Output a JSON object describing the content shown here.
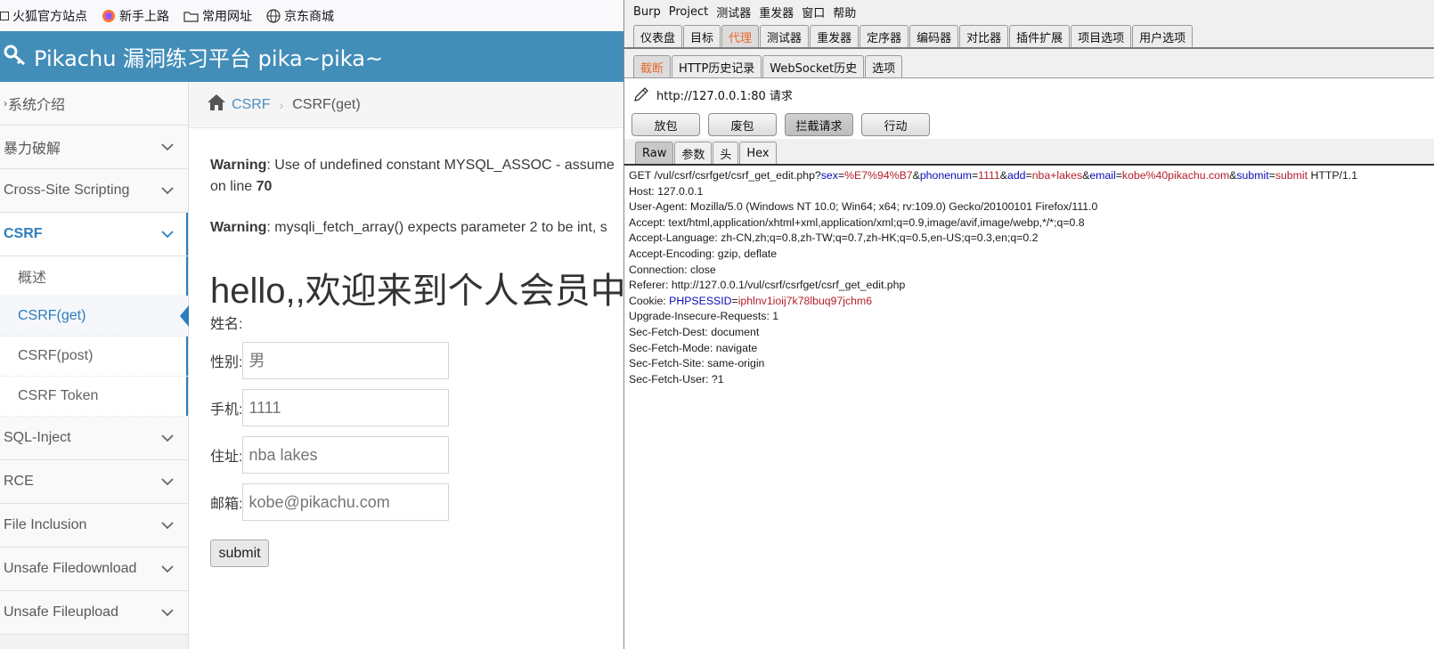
{
  "bookmarks": [
    {
      "icon": "checkbox-icon",
      "label": "火狐官方站点"
    },
    {
      "icon": "firefox-icon",
      "label": "新手上路"
    },
    {
      "icon": "folder-icon",
      "label": "常用网址"
    },
    {
      "icon": "globe-icon",
      "label": "京东商城"
    }
  ],
  "header": {
    "title": "Pikachu 漏洞练习平台 pika~pika~",
    "color": "#438eb9"
  },
  "sidebar": {
    "items": [
      {
        "label": "系统介绍"
      },
      {
        "label": "暴力破解"
      },
      {
        "label": "Cross-Site Scripting"
      },
      {
        "label": "CSRF"
      },
      {
        "label": "SQL-Inject"
      },
      {
        "label": "RCE"
      },
      {
        "label": "File Inclusion"
      },
      {
        "label": "Unsafe Filedownload"
      },
      {
        "label": "Unsafe Fileupload"
      }
    ],
    "csrf_sub": [
      {
        "label": "概述"
      },
      {
        "label": "CSRF(get)"
      },
      {
        "label": "CSRF(post)"
      },
      {
        "label": "CSRF Token"
      }
    ]
  },
  "breadcrumb": {
    "link": "CSRF",
    "separator": "›",
    "current": "CSRF(get)"
  },
  "main": {
    "warning1_label": "Warning",
    "warning1_text": ": Use of undefined constant MYSQL_ASSOC - assume",
    "warning1_line_prefix": "on line ",
    "warning1_line_no": "70",
    "warning2_label": "Warning",
    "warning2_text": ": mysqli_fetch_array() expects parameter 2 to be int, s",
    "hello": "hello,,欢迎来到个人会员中",
    "name_label": "姓名:",
    "fields": [
      {
        "label": "性别:",
        "placeholder": "男"
      },
      {
        "label": "手机:",
        "placeholder": "1111"
      },
      {
        "label": "住址:",
        "placeholder": "nba lakes"
      },
      {
        "label": "邮箱:",
        "placeholder": "kobe@pikachu.com"
      }
    ],
    "submit": "submit"
  },
  "burp": {
    "menu": [
      "Burp",
      "Project",
      "测试器",
      "重发器",
      "窗口",
      "帮助"
    ],
    "main_tabs": [
      "仪表盘",
      "目标",
      "代理",
      "测试器",
      "重发器",
      "定序器",
      "编码器",
      "对比器",
      "插件扩展",
      "项目选项",
      "用户选项"
    ],
    "main_tab_active": "代理",
    "proxy_tabs": [
      "截断",
      "HTTP历史记录",
      "WebSocket历史",
      "选项"
    ],
    "proxy_tab_active": "截断",
    "request_title": "http://127.0.0.1:80 请求",
    "buttons": [
      "放包",
      "废包",
      "拦截请求",
      "行动"
    ],
    "view_tabs": [
      "Raw",
      "参数",
      "头",
      "Hex"
    ],
    "view_tab_active": "Raw",
    "request_line": {
      "prefix": "GET /vul/csrf/csrfget/csrf_get_edit.php?",
      "params": [
        {
          "k": "sex",
          "v": "%E7%94%B7"
        },
        {
          "k": "phonenum",
          "v": "1111"
        },
        {
          "k": "add",
          "v": "nba+lakes"
        },
        {
          "k": "email",
          "v": "kobe%40pikachu.com"
        },
        {
          "k": "submit",
          "v": "submit"
        }
      ],
      "suffix": " HTTP/1.1"
    },
    "headers_before_cookie": [
      "Host: 127.0.0.1",
      "User-Agent: Mozilla/5.0 (Windows NT 10.0; Win64; x64; rv:109.0) Gecko/20100101 Firefox/111.0",
      "Accept: text/html,application/xhtml+xml,application/xml;q=0.9,image/avif,image/webp,*/*;q=0.8",
      "Accept-Language: zh-CN,zh;q=0.8,zh-TW;q=0.7,zh-HK;q=0.5,en-US;q=0.3,en;q=0.2",
      "Accept-Encoding: gzip, deflate",
      "Connection: close",
      "Referer: http://127.0.0.1/vul/csrf/csrfget/csrf_get_edit.php"
    ],
    "cookie": {
      "prefix": "Cookie: ",
      "k": "PHPSESSID",
      "v": "iphlnv1ioij7k78lbuq97jchm6"
    },
    "headers_after_cookie": [
      "Upgrade-Insecure-Requests: 1",
      "Sec-Fetch-Dest: document",
      "Sec-Fetch-Mode: navigate",
      "Sec-Fetch-Site: same-origin",
      "Sec-Fetch-User: ?1"
    ]
  }
}
